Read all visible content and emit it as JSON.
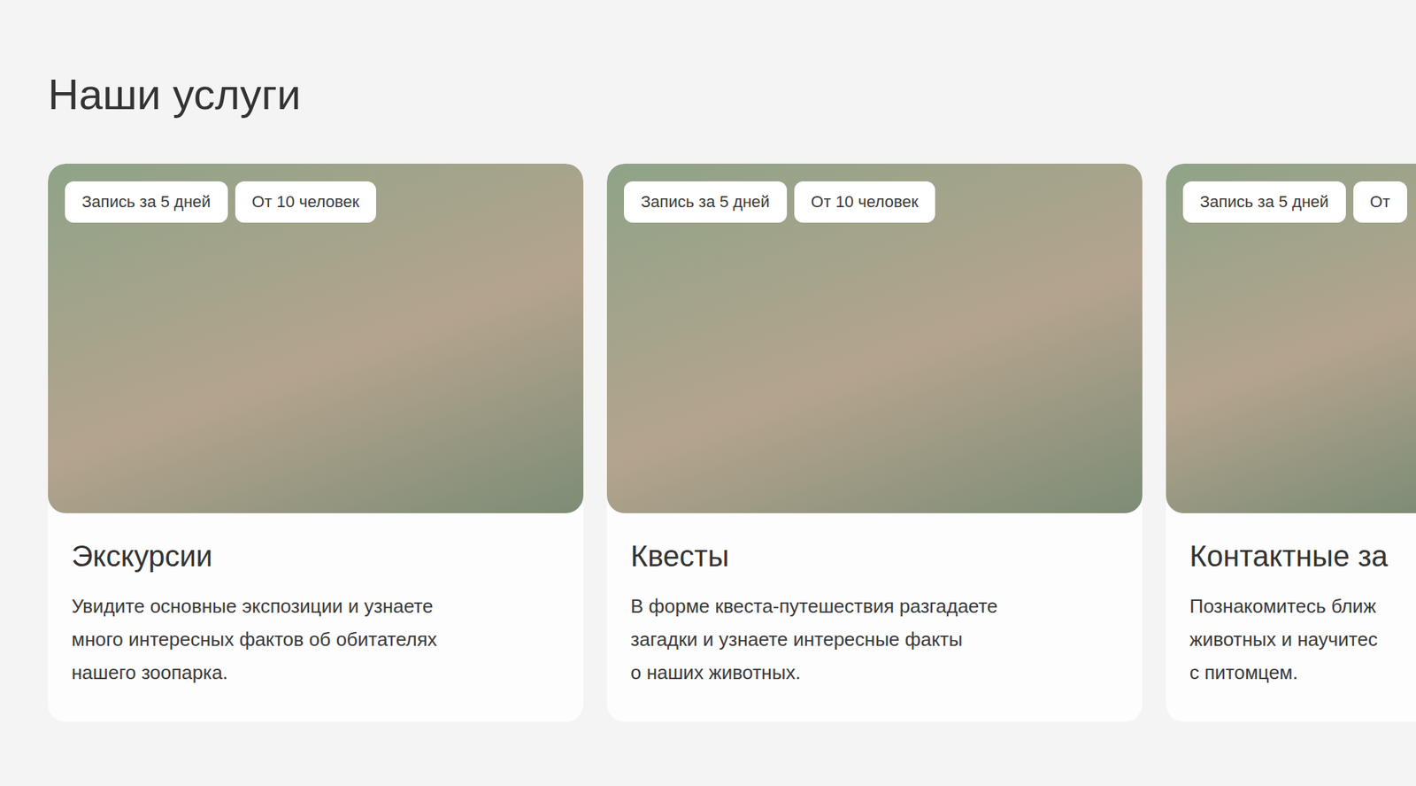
{
  "section": {
    "title": "Наши услуги"
  },
  "services": [
    {
      "tags": [
        "Запись за 5 дней",
        "От 10 человек"
      ],
      "name": "Экскурсии",
      "description": [
        "Увидите основные экспозиции и узнаете",
        "много интересных фактов об обитателях",
        "нашего зоопарка."
      ]
    },
    {
      "tags": [
        "Запись за 5 дней",
        "От 10 человек"
      ],
      "name": "Квесты",
      "description": [
        "В форме квеста-путешествия разгадаете",
        "загадки и узнаете интересные факты",
        "о наших животных."
      ]
    },
    {
      "tags": [
        "Запись за 5 дней",
        "От"
      ],
      "name": "Контактные за",
      "description": [
        "Познакомитесь ближ",
        "животных и научитес",
        "с питомцем."
      ]
    }
  ]
}
